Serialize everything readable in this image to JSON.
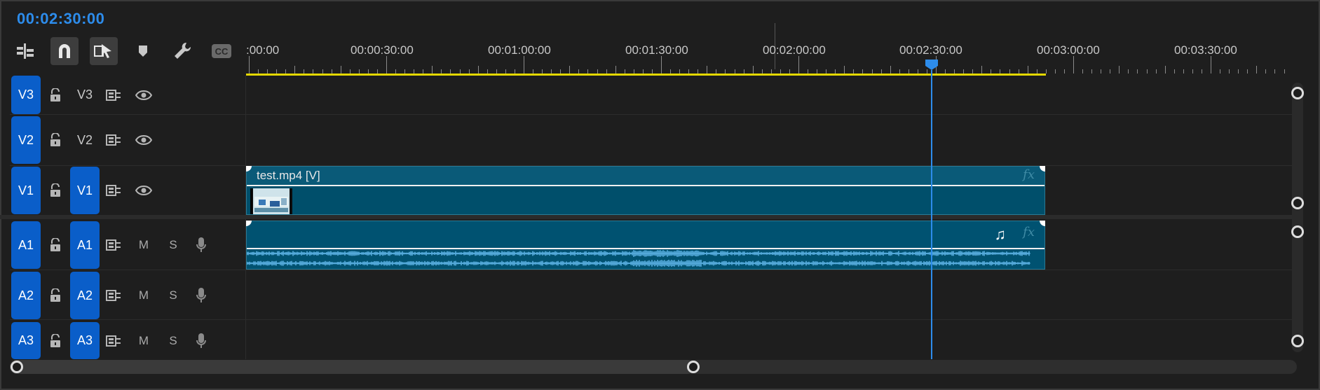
{
  "timecode": "00:02:30:00",
  "toolbar": {
    "items": [
      "insert-nest-icon",
      "snap-magnet-icon",
      "linked-selection-icon",
      "add-marker-icon",
      "settings-wrench-icon",
      "captions-cc-icon"
    ],
    "cc_label": "CC"
  },
  "ruler": {
    "labels": [
      ":00:00",
      "00:00:30:00",
      "00:01:00:00",
      "00:01:30:00",
      "00:02:00:00",
      "00:02:30:00",
      "00:03:00:00",
      "00:03:30:00"
    ]
  },
  "playhead": {
    "time": "00:02:30:00",
    "color": "#2d8ceb"
  },
  "work_area_color": "#e4d800",
  "tracks": {
    "video": [
      {
        "source": "V3",
        "target": "V3",
        "target_on": false
      },
      {
        "source": "V2",
        "target": "V2",
        "target_on": false
      },
      {
        "source": "V1",
        "target": "V1",
        "target_on": true
      }
    ],
    "audio": [
      {
        "source": "A1",
        "target": "A1",
        "mute": "M",
        "solo": "S"
      },
      {
        "source": "A2",
        "target": "A2",
        "mute": "M",
        "solo": "S"
      },
      {
        "source": "A3",
        "target": "A3",
        "mute": "M",
        "solo": "S"
      }
    ]
  },
  "clips": {
    "video": {
      "name": "test.mp4 [V]",
      "fx": "fx"
    },
    "audio": {
      "fx": "fx",
      "note": "♫"
    }
  },
  "colors": {
    "accent": "#0a5ec9",
    "clip": "#004f6b",
    "waveform": "#5fb4e8"
  }
}
